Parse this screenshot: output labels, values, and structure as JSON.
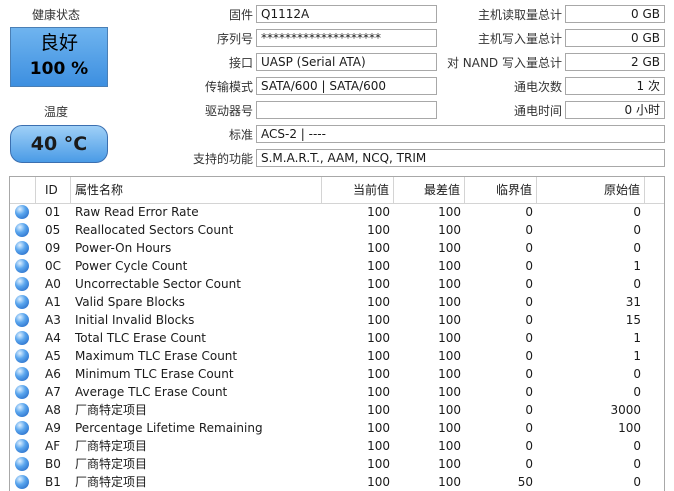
{
  "labels": {
    "health": "健康状态",
    "temperature": "温度",
    "firmware": "固件",
    "serial": "序列号",
    "interface": "接口",
    "transfer_mode": "传输模式",
    "drive_letter": "驱动器号",
    "standard": "标准",
    "features": "支持的功能",
    "host_reads": "主机读取量总计",
    "host_writes": "主机写入量总计",
    "nand_writes": "对 NAND 写入量总计",
    "power_on_count": "通电次数",
    "power_on_hours": "通电时间"
  },
  "health": {
    "status": "良好",
    "percent": "100 %"
  },
  "temperature": {
    "value": "40 °C"
  },
  "info": {
    "firmware": "Q1112A",
    "serial": "********************",
    "interface": "UASP (Serial ATA)",
    "transfer_mode": "SATA/600 | SATA/600",
    "drive_letter": "",
    "standard": "ACS-2 | ----",
    "features": "S.M.A.R.T., AAM, NCQ, TRIM",
    "host_reads": "0 GB",
    "host_writes": "0 GB",
    "nand_writes": "2 GB",
    "power_on_count": "1 次",
    "power_on_hours": "0 小时"
  },
  "table": {
    "headers": {
      "id": "ID",
      "name": "属性名称",
      "current": "当前值",
      "worst": "最差值",
      "threshold": "临界值",
      "raw": "原始值"
    },
    "rows": [
      {
        "id": "01",
        "name": "Raw Read Error Rate",
        "current": "100",
        "worst": "100",
        "threshold": "0",
        "raw": "0"
      },
      {
        "id": "05",
        "name": "Reallocated Sectors Count",
        "current": "100",
        "worst": "100",
        "threshold": "0",
        "raw": "0"
      },
      {
        "id": "09",
        "name": "Power-On Hours",
        "current": "100",
        "worst": "100",
        "threshold": "0",
        "raw": "0"
      },
      {
        "id": "0C",
        "name": "Power Cycle Count",
        "current": "100",
        "worst": "100",
        "threshold": "0",
        "raw": "1"
      },
      {
        "id": "A0",
        "name": "Uncorrectable Sector Count",
        "current": "100",
        "worst": "100",
        "threshold": "0",
        "raw": "0"
      },
      {
        "id": "A1",
        "name": "Valid Spare Blocks",
        "current": "100",
        "worst": "100",
        "threshold": "0",
        "raw": "31"
      },
      {
        "id": "A3",
        "name": "Initial Invalid Blocks",
        "current": "100",
        "worst": "100",
        "threshold": "0",
        "raw": "15"
      },
      {
        "id": "A4",
        "name": "Total TLC Erase Count",
        "current": "100",
        "worst": "100",
        "threshold": "0",
        "raw": "1"
      },
      {
        "id": "A5",
        "name": "Maximum TLC Erase Count",
        "current": "100",
        "worst": "100",
        "threshold": "0",
        "raw": "1"
      },
      {
        "id": "A6",
        "name": "Minimum TLC Erase Count",
        "current": "100",
        "worst": "100",
        "threshold": "0",
        "raw": "0"
      },
      {
        "id": "A7",
        "name": "Average TLC Erase Count",
        "current": "100",
        "worst": "100",
        "threshold": "0",
        "raw": "0"
      },
      {
        "id": "A8",
        "name": "厂商特定项目",
        "current": "100",
        "worst": "100",
        "threshold": "0",
        "raw": "3000"
      },
      {
        "id": "A9",
        "name": "Percentage Lifetime Remaining",
        "current": "100",
        "worst": "100",
        "threshold": "0",
        "raw": "100"
      },
      {
        "id": "AF",
        "name": "厂商特定项目",
        "current": "100",
        "worst": "100",
        "threshold": "0",
        "raw": "0"
      },
      {
        "id": "B0",
        "name": "厂商特定项目",
        "current": "100",
        "worst": "100",
        "threshold": "0",
        "raw": "0"
      },
      {
        "id": "B1",
        "name": "厂商特定项目",
        "current": "100",
        "worst": "100",
        "threshold": "50",
        "raw": "0"
      }
    ]
  },
  "colors": {
    "status_good": "#3d8fe0",
    "dot_blue": "#1c5fc0"
  }
}
